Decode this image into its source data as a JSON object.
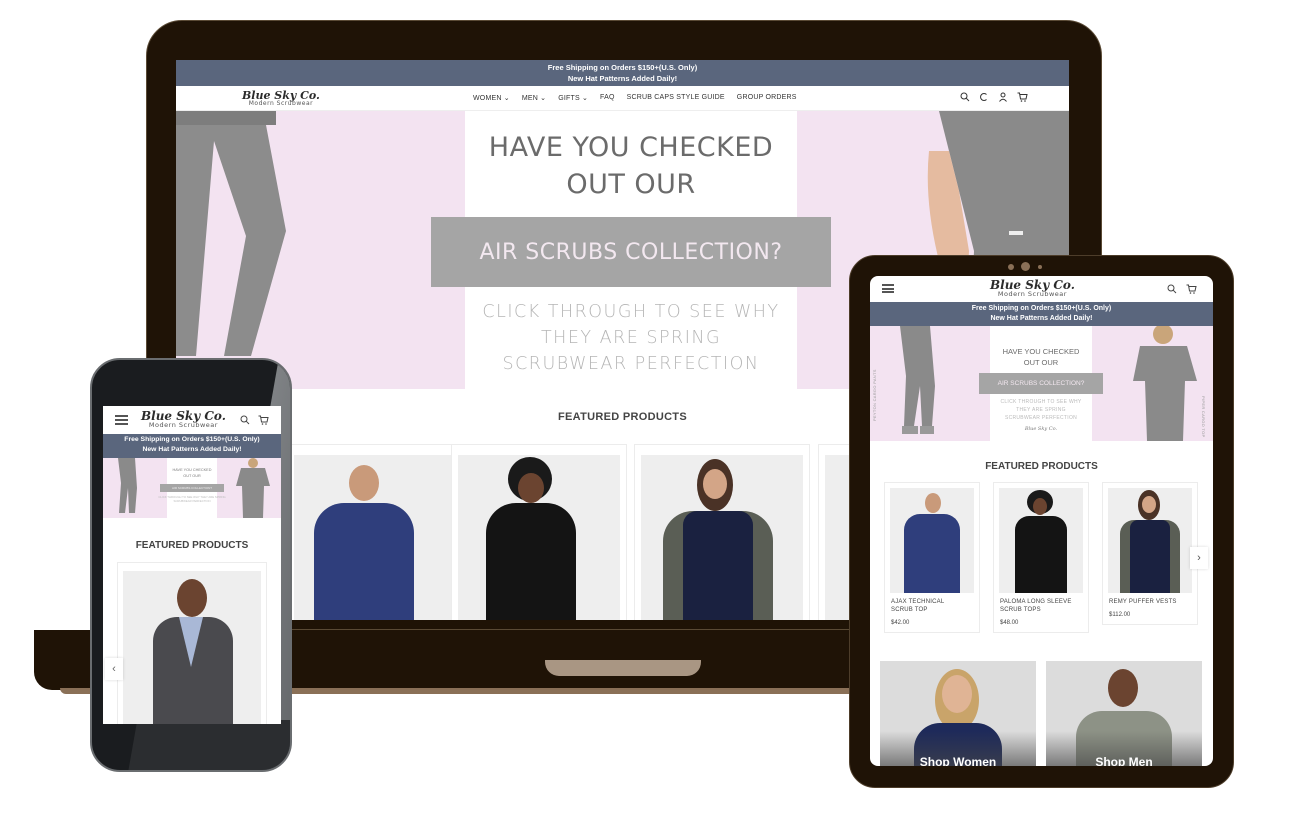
{
  "brand": {
    "name": "Blue Sky Co.",
    "tagline": "Modern Scrubwear",
    "promo_line1": "Free Shipping on Orders $150+(U.S. Only)",
    "promo_line2": "New Hat Patterns Added Daily!",
    "colors": {
      "promo_bar": "#5a667d",
      "hero_pink": "#f3e3f1",
      "hero_button": "#a5a5a5",
      "device_frame": "#1f1306"
    }
  },
  "desktop": {
    "nav": [
      {
        "label": "WOMEN ⌄",
        "has_dropdown": true
      },
      {
        "label": "MEN ⌄",
        "has_dropdown": true
      },
      {
        "label": "GIFTS ⌄",
        "has_dropdown": true
      },
      {
        "label": "FAQ",
        "has_dropdown": false
      },
      {
        "label": "SCRUB CAPS STYLE GUIDE",
        "has_dropdown": false
      },
      {
        "label": "GROUP ORDERS",
        "has_dropdown": false
      }
    ],
    "icons": {
      "search": "⌕",
      "currency": "C",
      "account": "♙",
      "cart": "🛒"
    },
    "hero": {
      "line1": "HAVE YOU CHECKED",
      "line2": "OUT OUR",
      "button": "AIR SCRUBS COLLECTION?",
      "sub1": "CLICK THROUGH TO SEE WHY",
      "sub2": "THEY ARE SPRING",
      "sub3": "SCRUBWEAR PERFECTION"
    },
    "featured_title": "FEATURED PRODUCTS"
  },
  "tablet": {
    "hero": {
      "line1": "HAVE YOU CHECKED",
      "line2": "OUT OUR",
      "button": "AIR SCRUBS COLLECTION?",
      "sub1": "CLICK THROUGH TO SEE WHY",
      "sub2": "THEY ARE SPRING",
      "sub3": "SCRUBWEAR PERFECTION",
      "signature": "Blue Sky Co.",
      "left_label": "PEYTON CARGO PANTS",
      "right_label": "PIPER CARGO TOP"
    },
    "featured_title": "FEATURED PRODUCTS",
    "products": [
      {
        "name_line1": "AJAX TECHNICAL",
        "name_line2": "SCRUB TOP",
        "price": "$42.00"
      },
      {
        "name_line1": "PALOMA LONG SLEEVE",
        "name_line2": "SCRUB TOPS",
        "price": "$48.00"
      },
      {
        "name_line1": "REMY PUFFER VESTS",
        "name_line2": "",
        "price": "$112.00"
      }
    ],
    "next_arrow": "›",
    "categories": [
      {
        "label": "Shop Women"
      },
      {
        "label": "Shop Men"
      }
    ]
  },
  "phone": {
    "hero": {
      "line1": "HAVE YOU CHECKED",
      "line2": "OUT OUR",
      "button": "AIR SCRUBS COLLECTION?",
      "sub": "CLICK THROUGH TO SEE WHY THEY ARE SPRING SCRUBWEAR PERFECTION"
    },
    "featured_title": "FEATURED PRODUCTS",
    "prev_arrow": "‹"
  }
}
